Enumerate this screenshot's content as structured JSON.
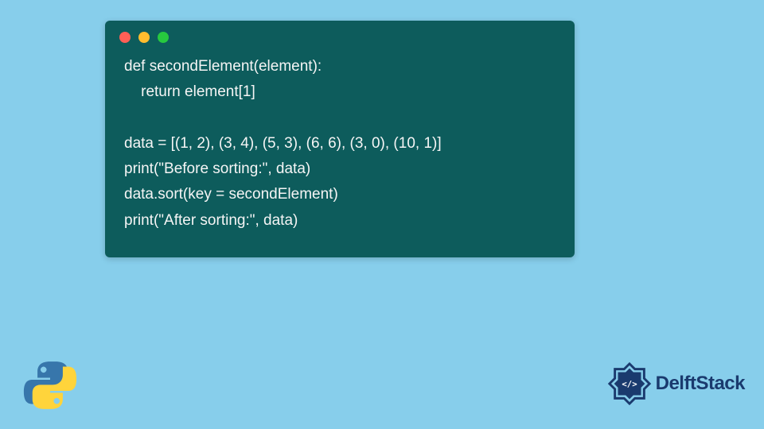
{
  "code": {
    "line1": "def secondElement(element):",
    "line2": "    return element[1]",
    "line3": "",
    "line4": "data = [(1, 2), (3, 4), (5, 3), (6, 6), (3, 0), (10, 1)]",
    "line5": "print(\"Before sorting:\", data)",
    "line6": "data.sort(key = secondElement)",
    "line7": "print(\"After sorting:\", data)"
  },
  "branding": {
    "name": "DelftStack"
  },
  "colors": {
    "background": "#87ceeb",
    "code_bg": "#0d5c5c",
    "code_text": "#f5f5f5",
    "brand_blue": "#1a3a6e"
  }
}
